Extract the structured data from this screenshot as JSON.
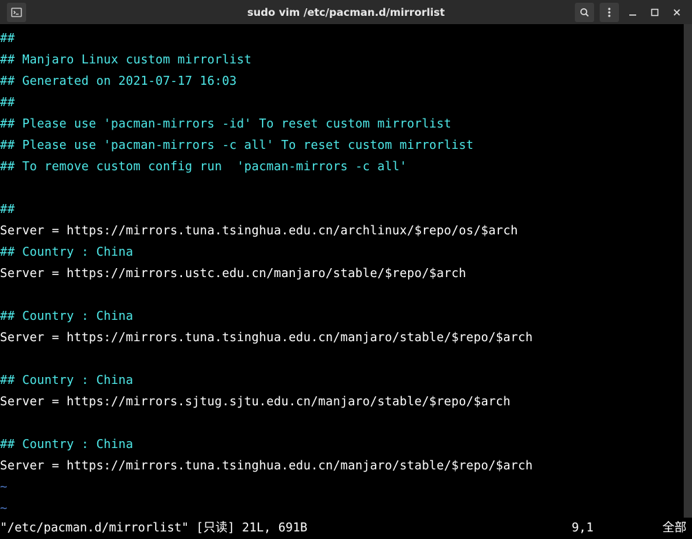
{
  "window": {
    "title": "sudo vim /etc/pacman.d/mirrorlist"
  },
  "lines": [
    {
      "type": "comment",
      "text": "##"
    },
    {
      "type": "comment",
      "text": "## Manjaro Linux custom mirrorlist"
    },
    {
      "type": "comment",
      "text": "## Generated on 2021-07-17 16:03"
    },
    {
      "type": "comment",
      "text": "##"
    },
    {
      "type": "comment",
      "text": "## Please use 'pacman-mirrors -id' To reset custom mirrorlist"
    },
    {
      "type": "comment",
      "text": "## Please use 'pacman-mirrors -c all' To reset custom mirrorlist"
    },
    {
      "type": "comment",
      "text": "## To remove custom config run  'pacman-mirrors -c all'"
    },
    {
      "type": "blank",
      "text": ""
    },
    {
      "type": "comment",
      "text": "##"
    },
    {
      "type": "plain",
      "text": "Server = https://mirrors.tuna.tsinghua.edu.cn/archlinux/$repo/os/$arch"
    },
    {
      "type": "comment",
      "text": "## Country : China"
    },
    {
      "type": "plain",
      "text": "Server = https://mirrors.ustc.edu.cn/manjaro/stable/$repo/$arch"
    },
    {
      "type": "blank",
      "text": ""
    },
    {
      "type": "comment",
      "text": "## Country : China"
    },
    {
      "type": "plain",
      "text": "Server = https://mirrors.tuna.tsinghua.edu.cn/manjaro/stable/$repo/$arch"
    },
    {
      "type": "blank",
      "text": ""
    },
    {
      "type": "comment",
      "text": "## Country : China"
    },
    {
      "type": "plain",
      "text": "Server = https://mirrors.sjtug.sjtu.edu.cn/manjaro/stable/$repo/$arch"
    },
    {
      "type": "blank",
      "text": ""
    },
    {
      "type": "comment",
      "text": "## Country : China"
    },
    {
      "type": "plain",
      "text": "Server = https://mirrors.tuna.tsinghua.edu.cn/manjaro/stable/$repo/$arch"
    },
    {
      "type": "tilde",
      "text": "~"
    },
    {
      "type": "tilde",
      "text": "~"
    }
  ],
  "status": {
    "left": "\"/etc/pacman.d/mirrorlist\" [只读] 21L, 691B",
    "mid": "9,1",
    "right": "全部"
  }
}
